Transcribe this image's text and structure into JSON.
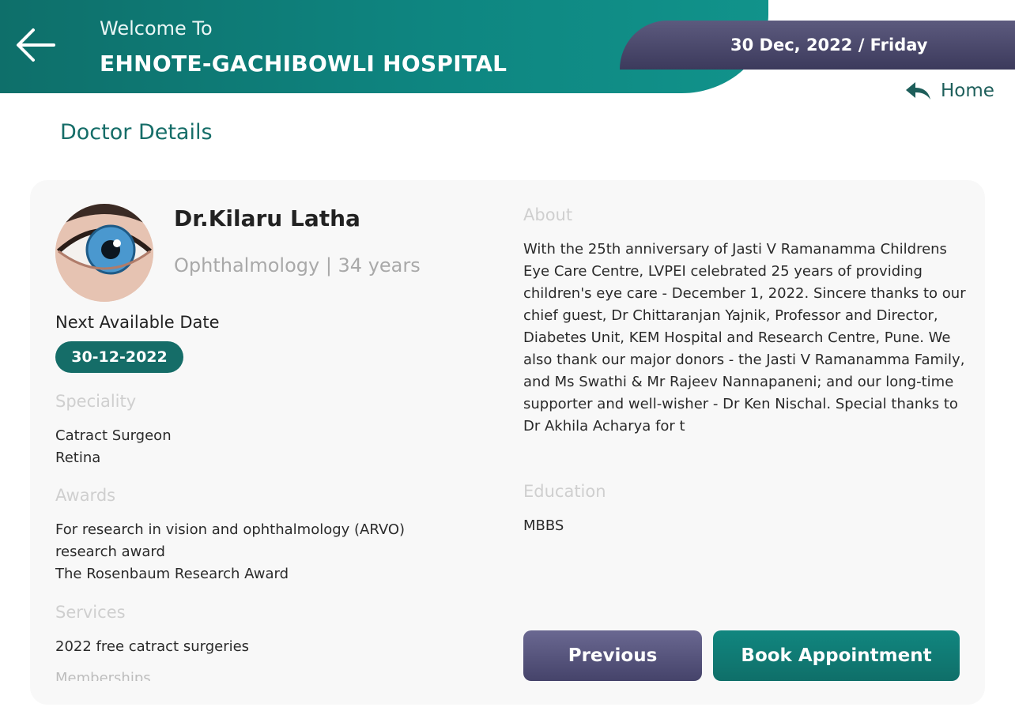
{
  "header": {
    "welcome": "Welcome To",
    "hospital_name": "EHNOTE-GACHIBOWLI HOSPITAL",
    "date": "30 Dec, 2022 / Friday",
    "home_label": "Home"
  },
  "page_title": "Doctor Details",
  "doctor": {
    "name": "Dr.Kilaru Latha",
    "meta": "Ophthalmology | 34 years",
    "next_available_label": "Next Available Date",
    "next_available_date": "30-12-2022",
    "speciality_label": "Speciality",
    "speciality": [
      "Catract Surgeon",
      "Retina"
    ],
    "awards_label": "Awards",
    "awards": [
      "For research in vision and ophthalmology (ARVO) research award",
      "The Rosenbaum Research Award"
    ],
    "services_label": "Services",
    "services": [
      "2022 free catract surgeries"
    ],
    "cutoff_label": "Memberships",
    "about_label": "About",
    "about": "With the 25th anniversary of Jasti V Ramanamma Childrens Eye Care Centre, LVPEI celebrated 25 years of providing children's eye care - December 1, 2022. Sincere thanks to our chief guest, Dr Chittaranjan Yajnik, Professor and Director, Diabetes Unit, KEM Hospital and Research Centre, Pune. We also thank our major donors - the Jasti V Ramanamma Family, and Ms Swathi & Mr Rajeev Nannapaneni; and our long-time supporter and well-wisher - Dr Ken Nischal. Special thanks to Dr Akhila Acharya for t",
    "education_label": "Education",
    "education": "MBBS"
  },
  "buttons": {
    "previous": "Previous",
    "book": "Book Appointment"
  },
  "colors": {
    "teal": "#156d68",
    "navy": "#45436a"
  }
}
